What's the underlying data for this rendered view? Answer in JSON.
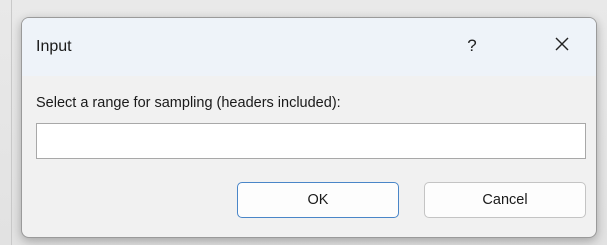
{
  "dialog": {
    "title": "Input",
    "help_label": "?",
    "prompt": "Select a range for sampling (headers included):",
    "input_value": "",
    "ok_label": "OK",
    "cancel_label": "Cancel"
  },
  "icons": {
    "close": "close-icon"
  },
  "colors": {
    "titlebar": "#eef3f9",
    "dialog_bg": "#f1f1f1",
    "ok_border": "#4a86c8"
  }
}
